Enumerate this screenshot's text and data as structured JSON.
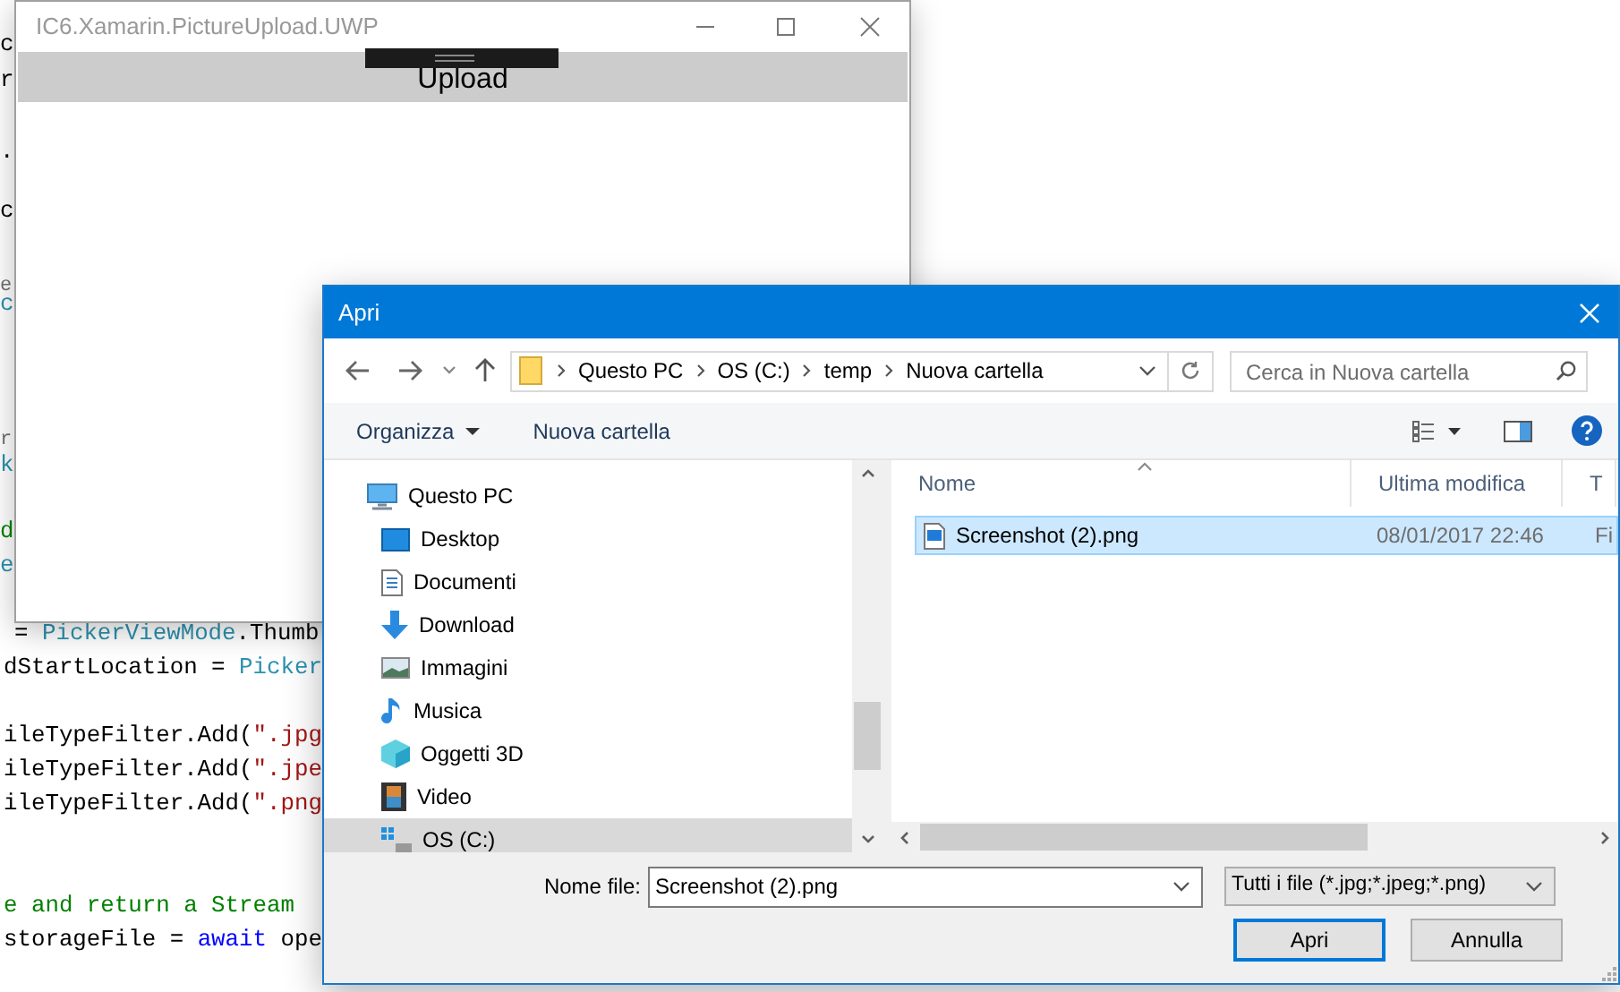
{
  "code_editor": {
    "edge_fragments": [
      {
        "text": "c",
        "kind": "plain"
      },
      {
        "text": "r",
        "kind": "plain"
      },
      {
        "text": ".",
        "kind": "plain"
      },
      {
        "text": "c",
        "kind": "plain"
      },
      {
        "text": "e",
        "kind": "annotation"
      },
      {
        "text": "c",
        "kind": "type"
      },
      {
        "text": "r",
        "kind": "annotation"
      },
      {
        "text": "k",
        "kind": "type"
      },
      {
        "text": "d",
        "kind": "comment"
      },
      {
        "text": "e",
        "kind": "type"
      }
    ],
    "lines": [
      {
        "tokens": [
          {
            "text": "= ",
            "kind": "plain"
          },
          {
            "text": "PickerViewMode",
            "kind": "type"
          },
          {
            "text": ".Thumb",
            "kind": "plain"
          }
        ]
      },
      {
        "tokens": [
          {
            "text": "dStartLocation = ",
            "kind": "plain"
          },
          {
            "text": "Picker",
            "kind": "type"
          }
        ]
      },
      {
        "tokens": [
          {
            "text": "ileTypeFilter.Add(",
            "kind": "plain"
          },
          {
            "text": "\".jpg",
            "kind": "string"
          }
        ]
      },
      {
        "tokens": [
          {
            "text": "ileTypeFilter.Add(",
            "kind": "plain"
          },
          {
            "text": "\".jpe",
            "kind": "string"
          }
        ]
      },
      {
        "tokens": [
          {
            "text": "ileTypeFilter.Add(",
            "kind": "plain"
          },
          {
            "text": "\".png",
            "kind": "string"
          }
        ]
      },
      {
        "tokens": [
          {
            "text": "e and return a Stream",
            "kind": "comment"
          }
        ]
      },
      {
        "tokens": [
          {
            "text": "storageFile = ",
            "kind": "plain"
          },
          {
            "text": "await",
            "kind": "keyword"
          },
          {
            "text": " ope",
            "kind": "plain"
          }
        ]
      }
    ]
  },
  "app_window": {
    "title": "IC6.Xamarin.PictureUpload.UWP",
    "upload_button": "Upload"
  },
  "dialog": {
    "title": "Apri",
    "address_bar": {
      "breadcrumbs": [
        "Questo PC",
        "OS (C:)",
        "temp",
        "Nuova cartella"
      ]
    },
    "search": {
      "placeholder": "Cerca in Nuova cartella"
    },
    "toolbar": {
      "organize": "Organizza",
      "new_folder": "Nuova cartella"
    },
    "nav_pane": {
      "items": [
        {
          "label": "Questo PC",
          "selected": false,
          "children": [
            {
              "label": "Desktop",
              "selected": false
            },
            {
              "label": "Documenti",
              "selected": false
            },
            {
              "label": "Download",
              "selected": false
            },
            {
              "label": "Immagini",
              "selected": false
            },
            {
              "label": "Musica",
              "selected": false
            },
            {
              "label": "Oggetti 3D",
              "selected": false
            },
            {
              "label": "Video",
              "selected": false
            },
            {
              "label": "OS (C:)",
              "selected": true
            }
          ]
        }
      ]
    },
    "file_list": {
      "columns": [
        "Nome",
        "Ultima modifica",
        "T"
      ],
      "rows": [
        {
          "name": "Screenshot (2).png",
          "modified": "08/01/2017 22:46",
          "column_3": "Fi",
          "selected": true
        }
      ]
    },
    "file_name": {
      "label": "Nome file:",
      "value": "Screenshot (2).png"
    },
    "file_type": "Tutti i file (*.jpg;*.jpeg;*.png)",
    "buttons": [
      {
        "label": "Apri",
        "default": true
      },
      {
        "label": "Annulla",
        "default": false
      }
    ]
  }
}
